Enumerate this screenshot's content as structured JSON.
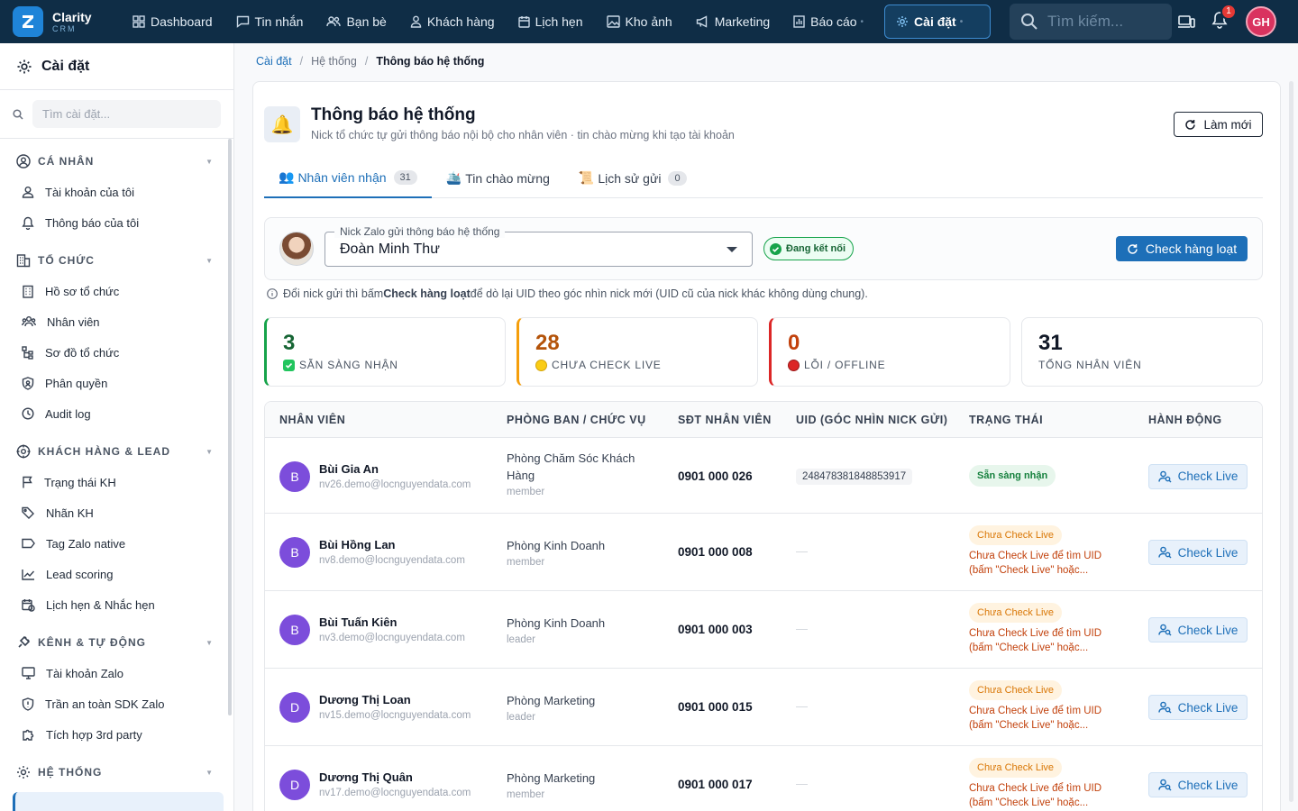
{
  "app": {
    "name": "Clarity",
    "sub": "CRM"
  },
  "topnav": {
    "items": [
      {
        "label": "Dashboard",
        "icon": "grid-icon"
      },
      {
        "label": "Tin nhắn",
        "icon": "message-icon"
      },
      {
        "label": "Bạn bè",
        "icon": "friends-icon"
      },
      {
        "label": "Khách hàng",
        "icon": "user-icon"
      },
      {
        "label": "Lịch hẹn",
        "icon": "calendar-icon"
      },
      {
        "label": "Kho ảnh",
        "icon": "image-icon"
      },
      {
        "label": "Marketing",
        "icon": "megaphone-icon"
      },
      {
        "label": "Báo cáo",
        "icon": "chart-icon"
      }
    ],
    "active": "Cài đặt",
    "search_placeholder": "Tìm kiếm...",
    "notification_count": "1",
    "user_initials": "GH"
  },
  "sidebar": {
    "title": "Cài đặt",
    "search_placeholder": "Tìm cài đặt...",
    "groups": [
      {
        "label": "CÁ NHÂN",
        "items": [
          "Tài khoản của tôi",
          "Thông báo của tôi"
        ]
      },
      {
        "label": "TỔ CHỨC",
        "items": [
          "Hồ sơ tổ chức",
          "Nhân viên",
          "Sơ đồ tổ chức",
          "Phân quyền",
          "Audit log"
        ]
      },
      {
        "label": "KHÁCH HÀNG & LEAD",
        "items": [
          "Trạng thái KH",
          "Nhãn KH",
          "Tag Zalo native",
          "Lead scoring",
          "Lịch hẹn & Nhắc hẹn"
        ]
      },
      {
        "label": "KÊNH & TỰ ĐỘNG",
        "items": [
          "Tài khoản Zalo",
          "Trần an toàn SDK Zalo",
          "Tích hợp 3rd party"
        ]
      },
      {
        "label": "HỆ THỐNG",
        "items": []
      }
    ]
  },
  "breadcrumb": [
    "Cài đặt",
    "Hệ thống",
    "Thông báo hệ thống"
  ],
  "page": {
    "title": "Thông báo hệ thống",
    "subtitle": "Nick tổ chức tự gửi thông báo nội bộ cho nhân viên · tin chào mừng khi tạo tài khoản",
    "refresh_label": "Làm mới"
  },
  "tabs": [
    {
      "emoji": "👥",
      "label": "Nhân viên nhận",
      "count": "31"
    },
    {
      "emoji": "🛳️",
      "label": "Tin chào mừng",
      "count": ""
    },
    {
      "emoji": "📜",
      "label": "Lịch sử gửi",
      "count": "0"
    }
  ],
  "sender": {
    "field_label": "Nick Zalo gửi thông báo hệ thống",
    "value": "Đoàn Minh Thư",
    "status": "Đang kết nối",
    "check_all_label": "Check hàng loạt"
  },
  "hint": {
    "before": "Đổi nick gửi thì bấm",
    "bold": "Check hàng loạt",
    "after": "để dò lại UID theo góc nhìn nick mới (UID cũ của nick khác không dùng chung)."
  },
  "stats": [
    {
      "value": "3",
      "label": "SẴN SÀNG NHẬN",
      "color": "#16a34a",
      "num_color": "#166534",
      "mark": "check"
    },
    {
      "value": "28",
      "label": "CHƯA CHECK LIVE",
      "color": "#f59e0b",
      "num_color": "#b45309",
      "mark": "yellow"
    },
    {
      "value": "0",
      "label": "LỖI / OFFLINE",
      "color": "#dc2626",
      "num_color": "#c2410c",
      "mark": "red"
    },
    {
      "value": "31",
      "label": "TỔNG NHÂN VIÊN",
      "color": "#e5e7eb",
      "num_color": "#111827",
      "mark": ""
    }
  ],
  "table": {
    "headers": [
      "NHÂN VIÊN",
      "PHÒNG BAN / CHỨC VỤ",
      "SĐT NHÂN VIÊN",
      "UID (GÓC NHÌN NICK GỬI)",
      "TRẠNG THÁI",
      "HÀNH ĐỘNG"
    ],
    "action_label": "Check Live",
    "rows": [
      {
        "initial": "B",
        "name": "Bùi Gia An",
        "email": "nv26.demo@locnguyendata.com",
        "dept": "Phòng Chăm Sóc Khách Hàng",
        "role": "member",
        "phone": "0901 000 026",
        "uid": "248478381848853917",
        "status": "Sẵn sàng nhận",
        "ok": true,
        "note": ""
      },
      {
        "initial": "B",
        "name": "Bùi Hồng Lan",
        "email": "nv8.demo@locnguyendata.com",
        "dept": "Phòng Kinh Doanh",
        "role": "member",
        "phone": "0901 000 008",
        "uid": "—",
        "status": "Chưa Check Live",
        "ok": false,
        "note": "Chưa Check Live để tìm UID (bấm \"Check Live\" hoặc..."
      },
      {
        "initial": "B",
        "name": "Bùi Tuấn Kiên",
        "email": "nv3.demo@locnguyendata.com",
        "dept": "Phòng Kinh Doanh",
        "role": "leader",
        "phone": "0901 000 003",
        "uid": "—",
        "status": "Chưa Check Live",
        "ok": false,
        "note": "Chưa Check Live để tìm UID (bấm \"Check Live\" hoặc..."
      },
      {
        "initial": "D",
        "name": "Dương Thị Loan",
        "email": "nv15.demo@locnguyendata.com",
        "dept": "Phòng Marketing",
        "role": "leader",
        "phone": "0901 000 015",
        "uid": "—",
        "status": "Chưa Check Live",
        "ok": false,
        "note": "Chưa Check Live để tìm UID (bấm \"Check Live\" hoặc..."
      },
      {
        "initial": "D",
        "name": "Dương Thị Quân",
        "email": "nv17.demo@locnguyendata.com",
        "dept": "Phòng Marketing",
        "role": "member",
        "phone": "0901 000 017",
        "uid": "—",
        "status": "Chưa Check Live",
        "ok": false,
        "note": "Chưa Check Live để tìm UID (bấm \"Check Live\" hoặc..."
      }
    ]
  }
}
